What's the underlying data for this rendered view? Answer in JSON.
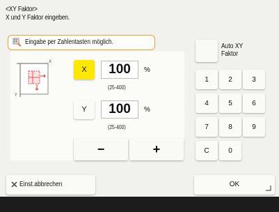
{
  "header": {
    "title_line1": "<XY Faktor>",
    "title_line2": "X und Y Faktor eingeben."
  },
  "hint": {
    "text": "Eingabe per Zahlentasten möglich.",
    "icon": "keypad-hint-icon",
    "border_color": "#f0a32a"
  },
  "x_factor": {
    "label": "X",
    "value": "100",
    "unit": "%",
    "range": "(25-400)",
    "selected_color": "#ffe800"
  },
  "y_factor": {
    "label": "Y",
    "value": "100",
    "unit": "%",
    "range": "(25-400)"
  },
  "adjust": {
    "minus_label": "−",
    "plus_label": "+"
  },
  "auto_xy": {
    "line1": "Auto XY",
    "line2": "Faktor"
  },
  "keypad": {
    "keys": [
      "1",
      "2",
      "3",
      "4",
      "5",
      "6",
      "7",
      "8",
      "9",
      "C",
      "0"
    ]
  },
  "footer": {
    "cancel_label": "Einst.abbrechen",
    "ok_label": "OK"
  }
}
